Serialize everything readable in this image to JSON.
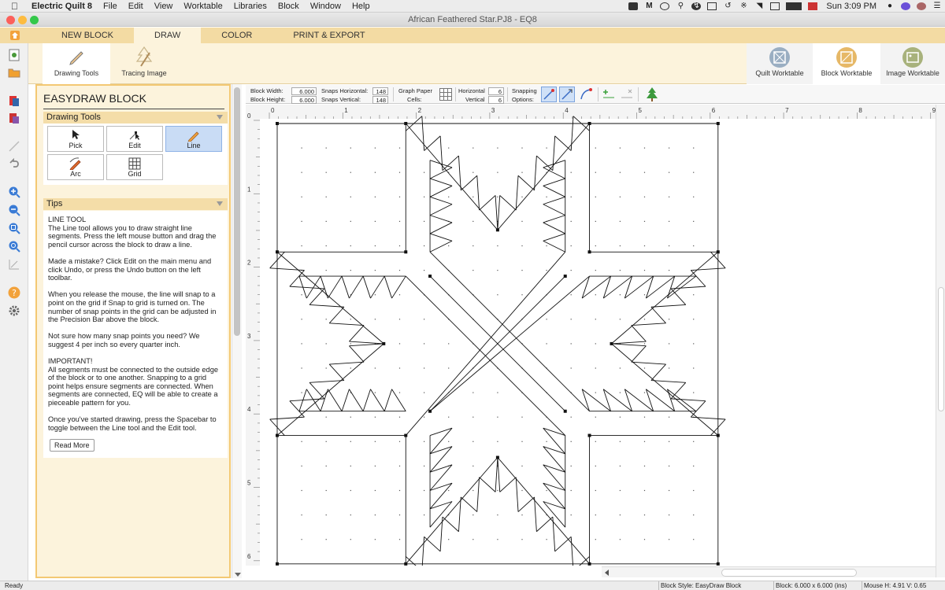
{
  "menubar": {
    "app_name": "Electric Quilt 8",
    "items": [
      "File",
      "Edit",
      "View",
      "Worktable",
      "Libraries",
      "Block",
      "Window",
      "Help"
    ],
    "clock": "Sun 3:09 PM"
  },
  "window": {
    "title": "African Feathered Star.PJ8 - EQ8"
  },
  "tabs": [
    {
      "label": "NEW BLOCK",
      "active": false
    },
    {
      "label": "DRAW",
      "active": true
    },
    {
      "label": "COLOR",
      "active": false
    },
    {
      "label": "PRINT & EXPORT",
      "active": false
    }
  ],
  "ribbon": {
    "drawing_tools": "Drawing Tools",
    "tracing_image": "Tracing Image",
    "quilt_worktable": "Quilt Worktable",
    "block_worktable": "Block Worktable",
    "image_worktable": "Image Worktable"
  },
  "panel": {
    "title": "EASYDRAW BLOCK",
    "tools_header": "Drawing Tools",
    "tools": [
      "Pick",
      "Edit",
      "Line",
      "Arc",
      "Grid"
    ],
    "selected_tool": "Line",
    "tips_header": "Tips",
    "tips": [
      "LINE TOOL\nThe Line tool allows you to draw straight line segments. Press the left mouse button and drag the pencil cursor across the block to draw a line.",
      "Made a mistake? Click Edit on the main menu and click Undo, or press the Undo button on the left toolbar.",
      "When you release the mouse, the line will snap to a point on the grid if Snap to grid is turned on. The number of snap points in the grid can be adjusted in the Precision Bar above the block.",
      "Not sure how many snap points you need? We suggest 4 per inch so every quarter inch.",
      "IMPORTANT!\nAll segments must be connected to the outside edge of the block or to one another. Snapping to a grid point helps ensure segments are connected. When segments are connected, EQ will be able to create a pieceable pattern for you.",
      "Once you've started drawing, press the Spacebar to toggle between the Line tool and the Edit tool."
    ],
    "read_more": "Read More"
  },
  "precision": {
    "block_width_label": "Block Width:",
    "block_width": "6.000",
    "block_height_label": "Block Height:",
    "block_height": "6.000",
    "snaps_h_label": "Snaps Horizontal:",
    "snaps_h": "148",
    "snaps_v_label": "Snaps Vertical:",
    "snaps_v": "148",
    "graph_label_1": "Graph Paper",
    "graph_label_2": "Cells:",
    "horizontal_label": "Horizontal",
    "horizontal": "6",
    "vertical_label": "Vertical",
    "vertical": "6",
    "snapping_label_1": "Snapping",
    "snapping_label_2": "Options:"
  },
  "rulers": {
    "h_numbers": [
      "0",
      "1",
      "2",
      "3",
      "4",
      "5",
      "6",
      "7",
      "8",
      "9"
    ],
    "v_numbers": [
      "0",
      "1",
      "2",
      "3",
      "4",
      "5",
      "6"
    ]
  },
  "status": {
    "ready": "Ready",
    "block_style": "Block Style: EasyDraw Block",
    "block_size": "Block: 6.000 x 6.000 (ins)",
    "mouse": "Mouse  H: 4.91   V: 0.65"
  },
  "colors": {
    "accent": "#f3c873",
    "ribbon": "#fcf3dc",
    "tabbar": "#f3dba3",
    "selected_tool": "#c9dcf5"
  }
}
